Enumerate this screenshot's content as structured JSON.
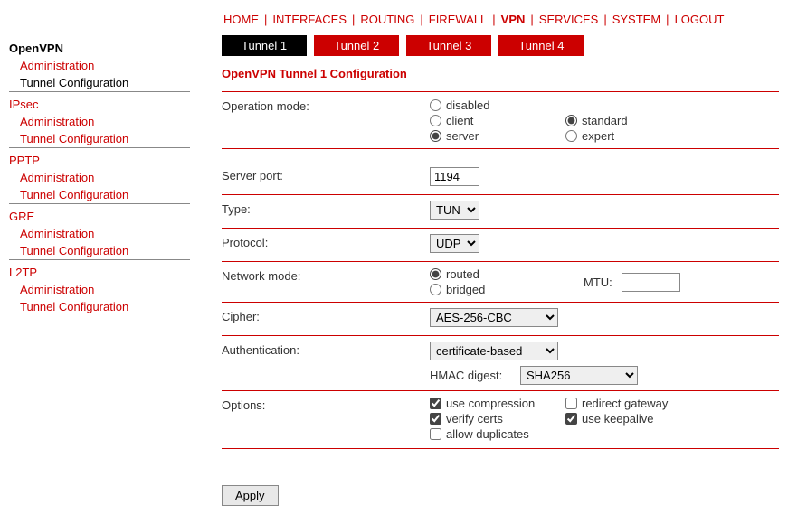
{
  "topnav": {
    "items": [
      {
        "label": "HOME",
        "active": false
      },
      {
        "label": "INTERFACES",
        "active": false
      },
      {
        "label": "ROUTING",
        "active": false
      },
      {
        "label": "FIREWALL",
        "active": false
      },
      {
        "label": "VPN",
        "active": true
      },
      {
        "label": "SERVICES",
        "active": false
      },
      {
        "label": "SYSTEM",
        "active": false
      },
      {
        "label": "LOGOUT",
        "active": false
      }
    ]
  },
  "sidebar": {
    "sections": [
      {
        "title": "OpenVPN",
        "active": true,
        "items": [
          {
            "label": "Administration",
            "active": false
          },
          {
            "label": "Tunnel Configuration",
            "active": true
          }
        ]
      },
      {
        "title": "IPsec",
        "active": false,
        "items": [
          {
            "label": "Administration",
            "active": false
          },
          {
            "label": "Tunnel Configuration",
            "active": false
          }
        ]
      },
      {
        "title": "PPTP",
        "active": false,
        "items": [
          {
            "label": "Administration",
            "active": false
          },
          {
            "label": "Tunnel Configuration",
            "active": false
          }
        ]
      },
      {
        "title": "GRE",
        "active": false,
        "items": [
          {
            "label": "Administration",
            "active": false
          },
          {
            "label": "Tunnel Configuration",
            "active": false
          }
        ]
      },
      {
        "title": "L2TP",
        "active": false,
        "items": [
          {
            "label": "Administration",
            "active": false
          },
          {
            "label": "Tunnel Configuration",
            "active": false
          }
        ]
      }
    ]
  },
  "tabs": [
    {
      "label": "Tunnel 1",
      "active": true
    },
    {
      "label": "Tunnel 2",
      "active": false
    },
    {
      "label": "Tunnel 3",
      "active": false
    },
    {
      "label": "Tunnel 4",
      "active": false
    }
  ],
  "page_title": "OpenVPN Tunnel 1 Configuration",
  "form": {
    "operation_mode": {
      "label": "Operation mode:",
      "left_options": [
        {
          "label": "disabled",
          "checked": false
        },
        {
          "label": "client",
          "checked": false
        },
        {
          "label": "server",
          "checked": true
        }
      ],
      "right_options": [
        {
          "label": "standard",
          "checked": true
        },
        {
          "label": "expert",
          "checked": false
        }
      ]
    },
    "server_port": {
      "label": "Server port:",
      "value": "1194"
    },
    "type": {
      "label": "Type:",
      "value": "TUN"
    },
    "protocol": {
      "label": "Protocol:",
      "value": "UDP"
    },
    "network_mode": {
      "label": "Network mode:",
      "options": [
        {
          "label": "routed",
          "checked": true
        },
        {
          "label": "bridged",
          "checked": false
        }
      ],
      "mtu_label": "MTU:",
      "mtu_value": ""
    },
    "cipher": {
      "label": "Cipher:",
      "value": "AES-256-CBC"
    },
    "authentication": {
      "label": "Authentication:",
      "value": "certificate-based",
      "hmac_label": "HMAC digest:",
      "hmac_value": "SHA256"
    },
    "options": {
      "label": "Options:",
      "items": [
        {
          "label": "use compression",
          "checked": true
        },
        {
          "label": "redirect gateway",
          "checked": false
        },
        {
          "label": "verify certs",
          "checked": true
        },
        {
          "label": "use keepalive",
          "checked": true
        },
        {
          "label": "allow duplicates",
          "checked": false
        }
      ]
    }
  },
  "apply_label": "Apply"
}
